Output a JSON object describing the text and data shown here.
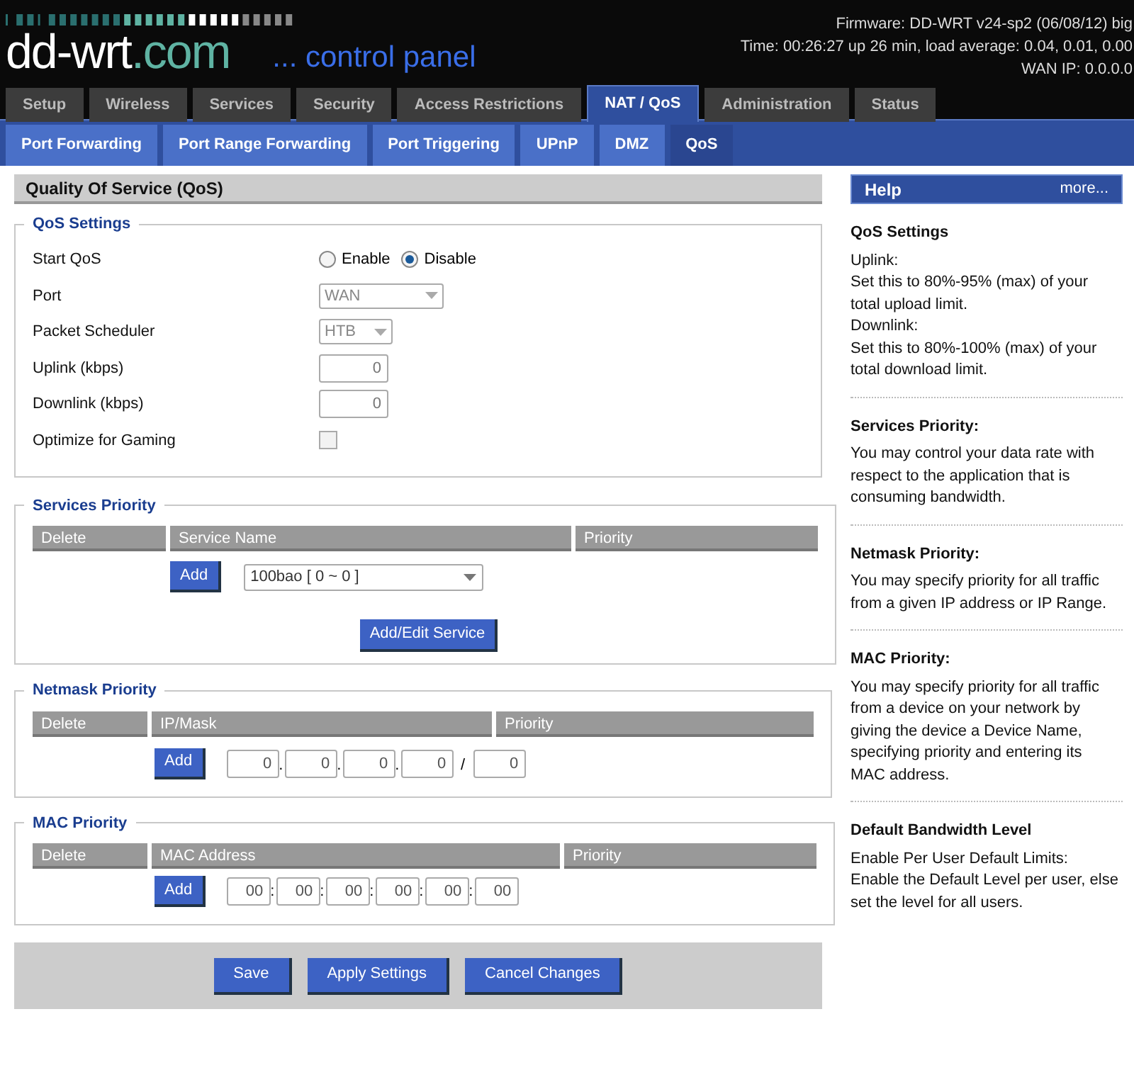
{
  "header": {
    "logo_main": "dd-wrt",
    "logo_suffix": ".com",
    "tagline": "... control panel",
    "info": [
      "Firmware: DD-WRT v24-sp2 (06/08/12) big",
      "Time: 00:26:27 up 26 min, load average: 0.04, 0.01, 0.00",
      "WAN IP: 0.0.0.0"
    ]
  },
  "tabs": [
    {
      "label": "Setup",
      "selected": false
    },
    {
      "label": "Wireless",
      "selected": false
    },
    {
      "label": "Services",
      "selected": false
    },
    {
      "label": "Security",
      "selected": false
    },
    {
      "label": "Access Restrictions",
      "selected": false
    },
    {
      "label": "NAT / QoS",
      "selected": true
    },
    {
      "label": "Administration",
      "selected": false
    },
    {
      "label": "Status",
      "selected": false
    }
  ],
  "subtabs": [
    {
      "label": "Port Forwarding",
      "selected": false
    },
    {
      "label": "Port Range Forwarding",
      "selected": false
    },
    {
      "label": "Port Triggering",
      "selected": false
    },
    {
      "label": "UPnP",
      "selected": false
    },
    {
      "label": "DMZ",
      "selected": false
    },
    {
      "label": "QoS",
      "selected": true
    }
  ],
  "page_title": "Quality Of Service (QoS)",
  "qos_settings": {
    "heading": "QoS Settings",
    "rows": [
      {
        "kind": "radio",
        "label": "Start QoS",
        "options": [
          {
            "label": "Enable",
            "selected": false
          },
          {
            "label": "Disable",
            "selected": true
          }
        ]
      },
      {
        "kind": "select",
        "label": "Port",
        "value": "WAN",
        "disabled": true
      },
      {
        "kind": "select",
        "label": "Packet Scheduler",
        "value": "HTB",
        "disabled": true
      },
      {
        "kind": "number",
        "label": "Uplink (kbps)",
        "value": "0",
        "disabled": true
      },
      {
        "kind": "number",
        "label": "Downlink (kbps)",
        "value": "0",
        "disabled": true
      },
      {
        "kind": "checkbox",
        "label": "Optimize for Gaming",
        "checked": false,
        "disabled": true
      }
    ]
  },
  "services_priority": {
    "heading": "Services Priority",
    "columns": [
      "Delete",
      "Service Name",
      "Priority"
    ],
    "add_button": "Add",
    "service_select": "100bao [ 0 ~ 0 ]",
    "edit_button": "Add/Edit Service"
  },
  "netmask_priority": {
    "heading": "Netmask Priority",
    "columns": [
      "Delete",
      "IP/Mask",
      "Priority"
    ],
    "add_button": "Add",
    "ip_octets": [
      "0",
      "0",
      "0",
      "0"
    ],
    "ip_separator": ".",
    "mask_separator": "/",
    "mask": "0"
  },
  "mac_priority": {
    "heading": "MAC Priority",
    "columns": [
      "Delete",
      "MAC Address",
      "Priority"
    ],
    "add_button": "Add",
    "mac_parts": [
      "00",
      "00",
      "00",
      "00",
      "00",
      "00"
    ],
    "mac_separator": ":"
  },
  "footer_buttons": [
    "Save",
    "Apply Settings",
    "Cancel Changes"
  ],
  "help": {
    "title": "Help",
    "more": "more...",
    "sections": [
      {
        "heading": "QoS Settings",
        "lines": [
          "Uplink:",
          "Set this to 80%-95% (max) of your total upload limit.",
          "Downlink:",
          "Set this to 80%-100% (max) of your total download limit."
        ]
      },
      {
        "heading": "Services Priority:",
        "lines": [
          "You may control your data rate with respect to the application that is consuming bandwidth."
        ]
      },
      {
        "heading": "Netmask Priority:",
        "lines": [
          "You may specify priority for all traffic from a given IP address or IP Range."
        ]
      },
      {
        "heading": "MAC Priority:",
        "lines": [
          "You may specify priority for all traffic from a device on your network by giving the device a Device Name, specifying priority and entering its MAC address."
        ]
      },
      {
        "heading": "Default Bandwidth Level",
        "lines": [
          "Enable Per User Default Limits:",
          "Enable the Default Level per user, else set the level for all users."
        ]
      }
    ]
  }
}
